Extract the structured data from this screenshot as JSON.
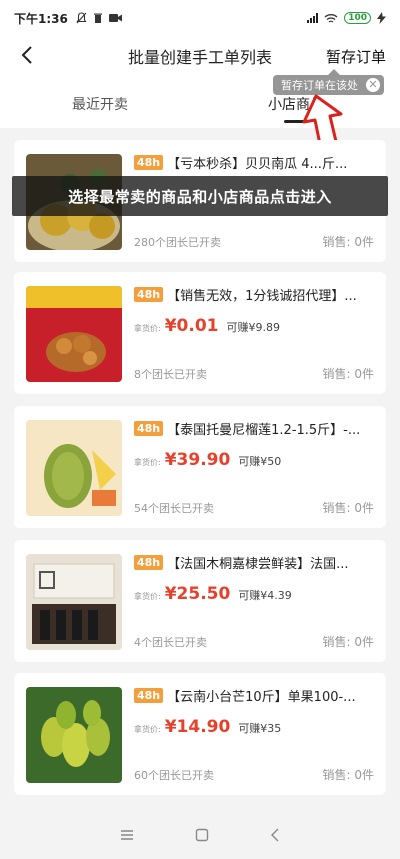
{
  "status": {
    "time": "下午1:36",
    "battery": "100"
  },
  "header": {
    "title": "批量创建手工单列表",
    "save_label": "暂存订单"
  },
  "tooltip": {
    "text": "暂存订单在该处"
  },
  "tabs": [
    {
      "label": "最近开卖"
    },
    {
      "label": "小店商品"
    }
  ],
  "banner": {
    "text": "选择最常卖的商品和小店商品点击进入"
  },
  "colors": {
    "accent": "#e8412b",
    "tag": "#f3a03c",
    "banner_bg": "#141414",
    "arrow": "#d9221c"
  },
  "products": [
    {
      "tag": "48h",
      "title": "【亏本秒杀】贝贝南瓜 4...斤...",
      "price_label": "",
      "price": "",
      "earn": "",
      "leaders": "280个团长已开卖",
      "sales": "销售: 0件",
      "thumb_icon": "pumpkin-photo"
    },
    {
      "tag": "48h",
      "title": "【销售无效，1分钱诚招代理】...",
      "price_label": "拿货价:",
      "price": "¥0.01",
      "earn": "可赚¥9.89",
      "leaders": "8个团长已开卖",
      "sales": "销售: 0件",
      "thumb_icon": "snack-photo"
    },
    {
      "tag": "48h",
      "title": "【泰国托曼尼榴莲1.2-1.5斤】-...",
      "price_label": "拿货价:",
      "price": "¥39.90",
      "earn": "可赚¥50",
      "leaders": "54个团长已开卖",
      "sales": "销售: 0件",
      "thumb_icon": "durian-photo"
    },
    {
      "tag": "48h",
      "title": "【法国木桐嘉棣尝鲜装】法国...",
      "price_label": "拿货价:",
      "price": "¥25.50",
      "earn": "可赚¥4.39",
      "leaders": "4个团长已开卖",
      "sales": "销售: 0件",
      "thumb_icon": "wine-box-photo"
    },
    {
      "tag": "48h",
      "title": "【云南小台芒10斤】单果100-...",
      "price_label": "拿货价:",
      "price": "¥14.90",
      "earn": "可赚¥35",
      "leaders": "60个团长已开卖",
      "sales": "销售: 0件",
      "thumb_icon": "mango-photo"
    }
  ],
  "navbar": {
    "items": [
      {
        "icon": "menu-icon"
      },
      {
        "icon": "home-icon"
      },
      {
        "icon": "back-icon"
      }
    ]
  }
}
